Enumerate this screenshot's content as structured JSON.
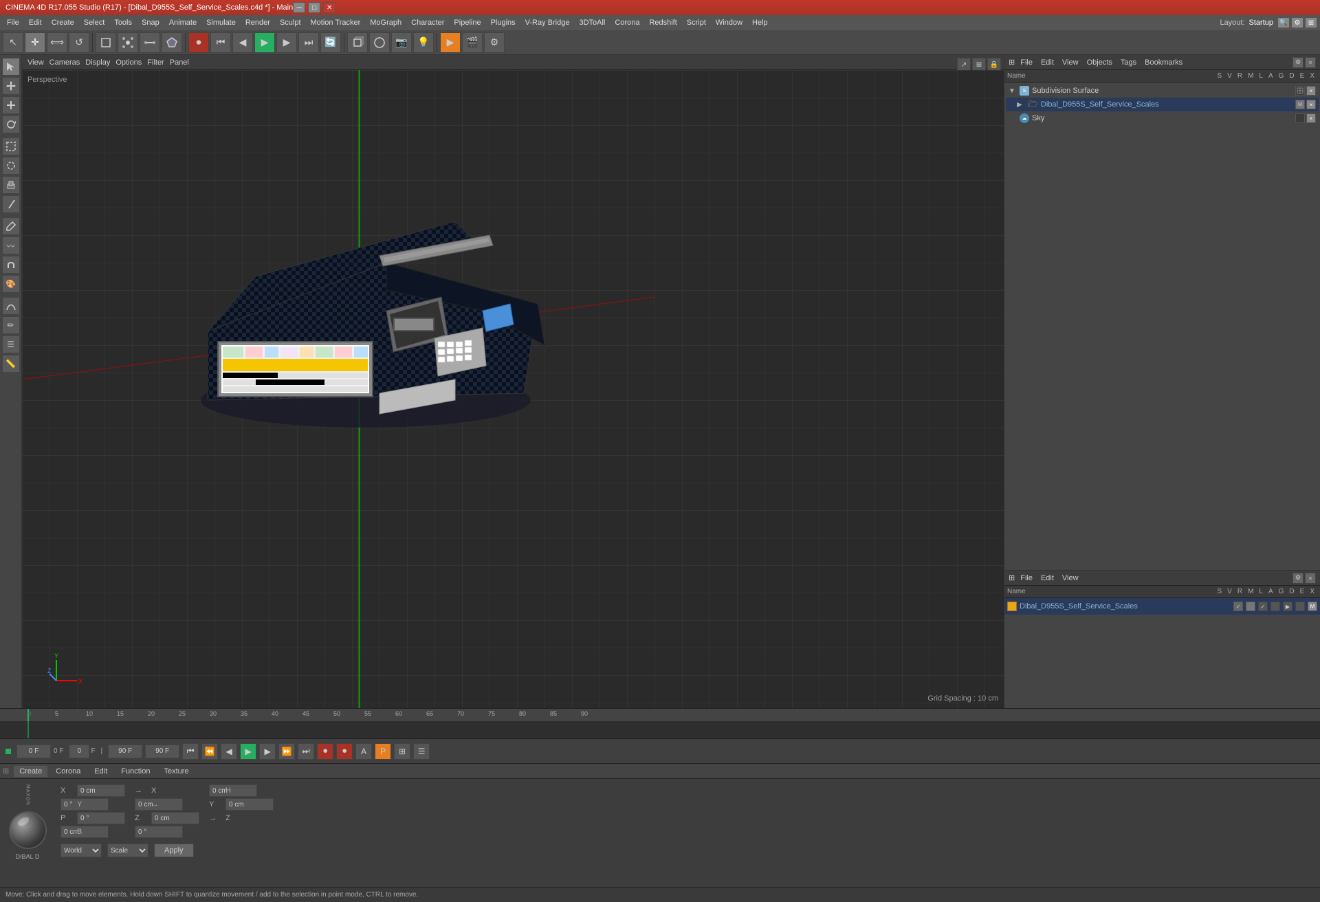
{
  "titleBar": {
    "text": "CINEMA 4D R17.055 Studio (R17) - [Dibal_D955S_Self_Service_Scales.c4d *] - Main",
    "minimize": "─",
    "restore": "□",
    "close": "✕"
  },
  "menuBar": {
    "items": [
      "File",
      "Edit",
      "Create",
      "Select",
      "Tools",
      "Snap",
      "Animate",
      "Simulate",
      "Render",
      "Sculpt",
      "Motion Tracker",
      "MoGraph",
      "Character",
      "Pipeline",
      "Plugins",
      "V-Ray Bridge",
      "3DToAll",
      "Corona",
      "Redshift",
      "Script",
      "Window",
      "Help"
    ]
  },
  "toolbar": {
    "layout_label": "Layout:",
    "layout_value": "Startup"
  },
  "viewport": {
    "viewMenu": "View",
    "camerasMenu": "Cameras",
    "displayMenu": "Display",
    "optionsMenu": "Options",
    "filterMenu": "Filter",
    "panelMenu": "Panel",
    "perspectiveLabel": "Perspective",
    "gridSpacing": "Grid Spacing : 10 cm"
  },
  "objectManager": {
    "title": "Objects",
    "menus": [
      "File",
      "Edit",
      "View",
      "Objects",
      "Tags",
      "Bookmarks"
    ],
    "items": [
      {
        "name": "Subdivision Surface",
        "type": "subdiv",
        "indent": 0,
        "expanded": true,
        "tags": [
          "check",
          "x"
        ]
      },
      {
        "name": "Dibal_D955S_Self_Service_Scales",
        "type": "folder",
        "indent": 1,
        "expanded": true,
        "tags": [
          "mat",
          "x"
        ]
      },
      {
        "name": "Sky",
        "type": "sky",
        "indent": 0,
        "expanded": false,
        "tags": [
          "check",
          "x"
        ]
      }
    ]
  },
  "materialManager": {
    "menus": [
      "File",
      "Edit",
      "View"
    ],
    "colHeaders": [
      "Name",
      "S",
      "V",
      "R",
      "M",
      "L",
      "A",
      "G",
      "D",
      "E",
      "X"
    ],
    "materials": [
      {
        "name": "Dibal_D955S_Self_Service_Scales",
        "color": "#e6a817"
      }
    ]
  },
  "bottomTabs": {
    "tabs": [
      "Create",
      "Corona",
      "Edit",
      "Function",
      "Texture"
    ]
  },
  "materialPreview": {
    "name": "DIBAL D"
  },
  "coordinates": {
    "x_pos": "0 cm",
    "y_pos": "0 cm",
    "z_pos": "0 cm",
    "x_rot": "0 °",
    "y_rot": "0 °",
    "z_rot": "0 °",
    "x_scale": "0 cm",
    "y_scale": "0 cm",
    "z_scale": "0 cm",
    "h": "0 °",
    "p": "0 °",
    "b": "0 °",
    "coord_system": "World",
    "scale_mode": "Scale",
    "apply_btn": "Apply"
  },
  "timeline": {
    "currentFrame": "0 F",
    "fps": "0 F",
    "startFrame": "0",
    "endFrame": "90 F",
    "endFrame2": "90 F",
    "ticks": [
      "0",
      "5",
      "10",
      "15",
      "20",
      "25",
      "30",
      "35",
      "40",
      "45",
      "50",
      "55",
      "60",
      "65",
      "70",
      "75",
      "80",
      "85",
      "90"
    ]
  },
  "statusBar": {
    "text": "Move: Click and drag to move elements. Hold down SHIFT to quantize movement / add to the selection in point mode, CTRL to remove."
  },
  "icons": {
    "pointer": "↖",
    "move": "✛",
    "scale": "⟺",
    "rotate": "↺",
    "undo": "↩",
    "redo": "↪",
    "render": "▶",
    "camera": "📷",
    "light": "💡",
    "cube": "◻",
    "sphere": "○",
    "cylinder": "⬤",
    "cone": "△",
    "plane": "▬",
    "spline": "〰",
    "nurbs": "⌇",
    "deformer": "⌁",
    "tag": "⊞",
    "material": "◈",
    "layer": "☰",
    "animation": "⏱",
    "play": "▶",
    "stop": "■",
    "prev": "⏮",
    "next": "⏭",
    "rewind": "◀◀",
    "forward": "▶▶"
  }
}
